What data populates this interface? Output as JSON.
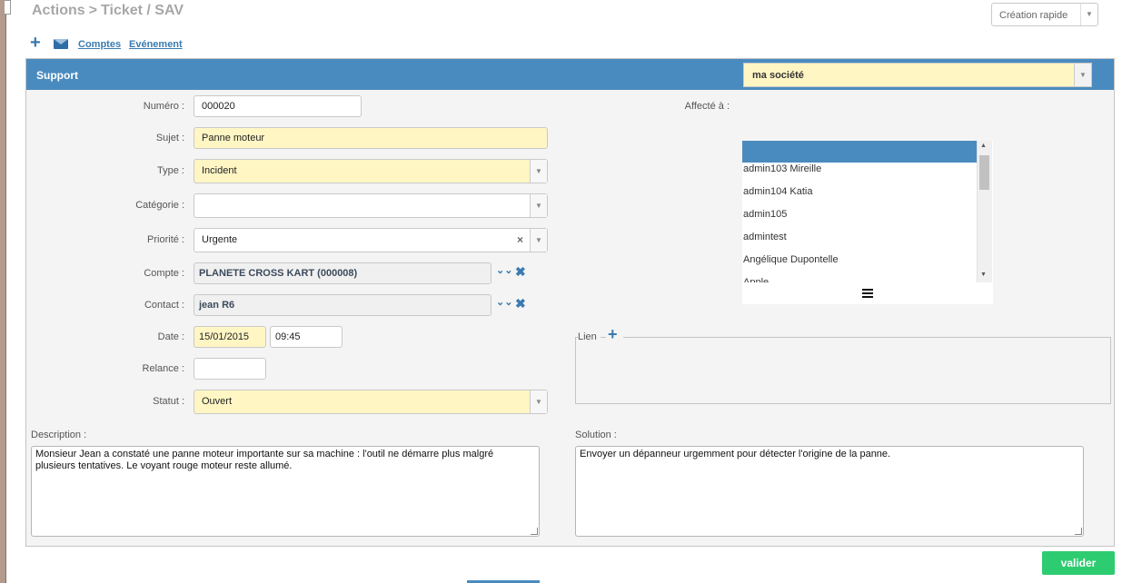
{
  "header": {
    "section": "Actions",
    "separator": ">",
    "page": "Ticket / SAV",
    "quick_create": "Création rapide"
  },
  "toolbar": {
    "links": [
      "Comptes",
      "Evénement"
    ]
  },
  "panel": {
    "title": "Support",
    "company": "ma société"
  },
  "form": {
    "numero": {
      "label": "Numéro :",
      "value": "000020"
    },
    "sujet": {
      "label": "Sujet :",
      "value": "Panne moteur"
    },
    "type": {
      "label": "Type :",
      "value": "Incident"
    },
    "categorie": {
      "label": "Catégorie :",
      "value": ""
    },
    "priorite": {
      "label": "Priorité :",
      "value": "Urgente"
    },
    "compte": {
      "label": "Compte :",
      "value": "PLANETE CROSS KART (000008)"
    },
    "contact": {
      "label": "Contact :",
      "value": "jean  R6"
    },
    "date": {
      "label": "Date :",
      "value": "15/01/2015",
      "time": "09:45"
    },
    "relance": {
      "label": "Relance :",
      "value": ""
    },
    "statut": {
      "label": "Statut :",
      "value": "Ouvert"
    }
  },
  "assign": {
    "label": "Affecté à :",
    "items": [
      "admin103 Mireille",
      "admin104 Katia",
      "admin105",
      "admintest",
      "Angélique Dupontelle",
      "Apple"
    ]
  },
  "lien": {
    "label": "Lien"
  },
  "description": {
    "label": "Description :",
    "value": "Monsieur Jean a constaté une panne moteur importante sur sa machine : l'outil ne démarre plus malgré plusieurs tentatives. Le voyant rouge moteur reste allumé."
  },
  "solution": {
    "label": "Solution :",
    "value": "Envoyer un dépanneur urgemment pour détecter l'origine de la panne."
  },
  "actions": {
    "submit": "valider"
  },
  "colors": {
    "header_blue": "#4a8bbf",
    "required_yellow": "#fff6c4",
    "submit_green": "#2ecc71"
  }
}
